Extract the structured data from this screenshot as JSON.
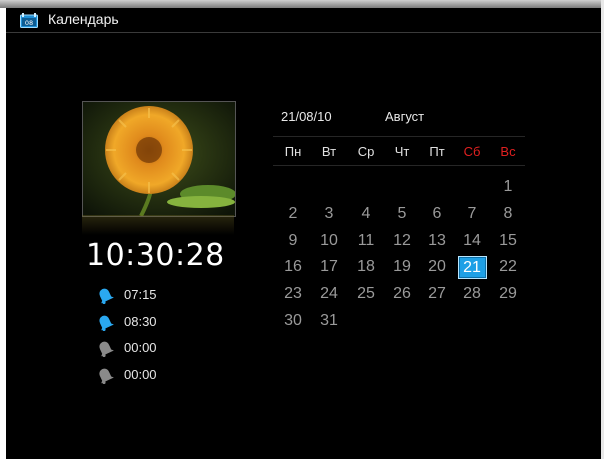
{
  "window": {
    "title": "Календарь",
    "icon": "calendar-icon"
  },
  "clock": {
    "time": "10:30:28"
  },
  "alarms": [
    {
      "time": "07:15",
      "active": true
    },
    {
      "time": "08:30",
      "active": true
    },
    {
      "time": "00:00",
      "active": false
    },
    {
      "time": "00:00",
      "active": false
    }
  ],
  "calendar": {
    "date": "21/08/10",
    "month": "Август",
    "weekdays": [
      "Пн",
      "Вт",
      "Ср",
      "Чт",
      "Пт",
      "Сб",
      "Вс"
    ],
    "selected_day": 21,
    "days": [
      "1",
      "2",
      "3",
      "4",
      "5",
      "6",
      "7",
      "8",
      "9",
      "10",
      "11",
      "12",
      "13",
      "14",
      "15",
      "16",
      "17",
      "18",
      "19",
      "20",
      "21",
      "22",
      "23",
      "24",
      "25",
      "26",
      "27",
      "28",
      "29",
      "30",
      "31"
    ]
  },
  "colors": {
    "accent": "#1ea0e6",
    "weekend": "#e02020",
    "alarm_active": "#2aa8f0",
    "alarm_inactive": "#8a8a8a"
  }
}
